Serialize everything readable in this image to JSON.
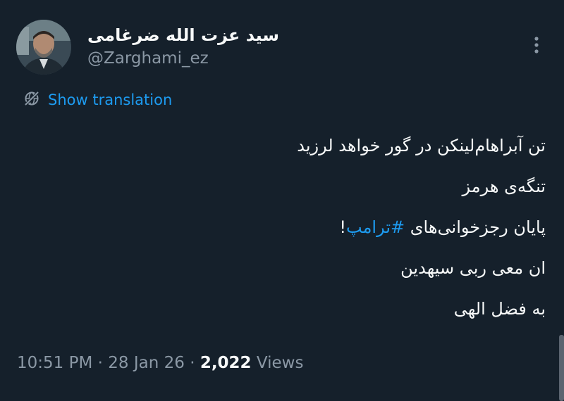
{
  "author": {
    "name": "سید عزت الله ضرغامی",
    "handle": "@Zarghami_ez"
  },
  "translation": {
    "label": "Show translation",
    "icon": "globe-slash-icon"
  },
  "tweet": {
    "lines": [
      "تن آبراهام‌لینکن در گور خواهد لرزید",
      "تنگه‌ی هرمز"
    ],
    "line3_prefix": "پایان رجزخوانی‌های ",
    "hashtag": "#ترامپ",
    "line3_suffix": "!",
    "lines_after": [
      "ان معی ربی سیهدین",
      "به فضل الهی"
    ]
  },
  "meta": {
    "time": "10:51 PM",
    "separator": "·",
    "date": "28 Jan 26",
    "views_count": "2,022",
    "views_label": "Views"
  },
  "colors": {
    "background": "#15202b",
    "text": "#f7f9f9",
    "secondary": "#8b98a5",
    "accent": "#1d9bf0"
  }
}
